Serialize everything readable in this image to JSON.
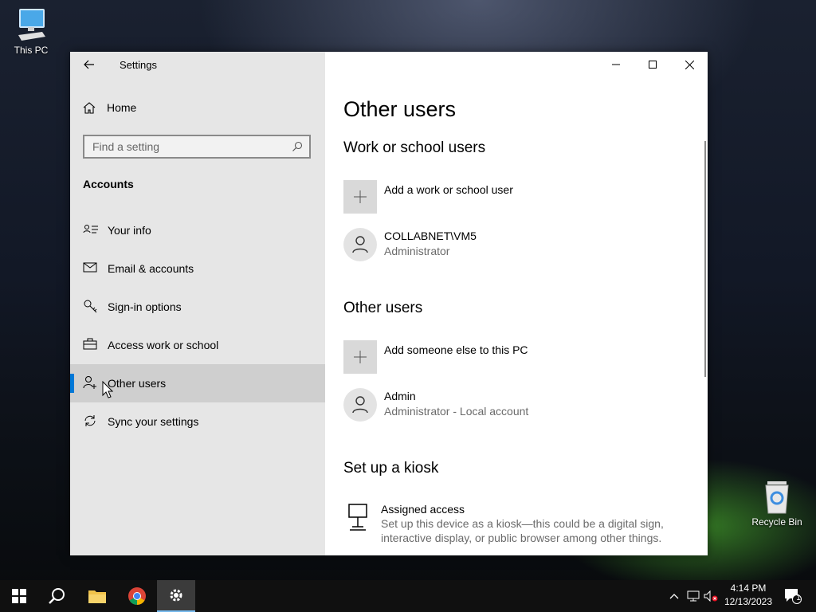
{
  "desktop": {
    "this_pc_label": "This PC",
    "recycle_bin_label": "Recycle Bin"
  },
  "window": {
    "title": "Settings",
    "icons": {
      "back": "back-arrow-icon",
      "minimize": "minimize-icon",
      "maximize": "maximize-icon",
      "close": "close-icon"
    }
  },
  "sidebar": {
    "home_label": "Home",
    "search_placeholder": "Find a setting",
    "section_title": "Accounts",
    "items": [
      {
        "label": "Your info",
        "icon": "contact-card-icon"
      },
      {
        "label": "Email & accounts",
        "icon": "mail-icon"
      },
      {
        "label": "Sign-in options",
        "icon": "key-icon"
      },
      {
        "label": "Access work or school",
        "icon": "briefcase-icon"
      },
      {
        "label": "Other users",
        "icon": "person-add-icon",
        "selected": true
      },
      {
        "label": "Sync your settings",
        "icon": "sync-icon"
      }
    ]
  },
  "main": {
    "page_title": "Other users",
    "work_section": {
      "title": "Work or school users",
      "add_label": "Add a work or school user",
      "user": {
        "name": "COLLABNET\\VM5",
        "role": "Administrator"
      }
    },
    "other_section": {
      "title": "Other users",
      "add_label": "Add someone else to this PC",
      "user": {
        "name": "Admin",
        "role": "Administrator - Local account"
      }
    },
    "kiosk_section": {
      "title": "Set up a kiosk",
      "item_title": "Assigned access",
      "item_desc_line1": "Set up this device as a kiosk—this could be a digital sign,",
      "item_desc_line2": "interactive display, or public browser among other things."
    }
  },
  "taskbar": {
    "time": "4:14 PM",
    "date": "12/13/2023",
    "notification_count": "1",
    "accent": "#76b9ed"
  },
  "colors": {
    "accent": "#0078d7",
    "sidebar_bg": "#e6e6e6"
  }
}
